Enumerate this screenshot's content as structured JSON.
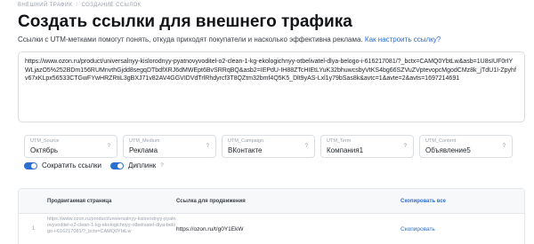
{
  "breadcrumb": {
    "items": [
      "ВНЕШНИЙ ТРАФИК",
      "СОЗДАНИЕ ССЫЛОК"
    ],
    "separator": "/"
  },
  "page": {
    "title": "Создать ссылки для внешнего трафика",
    "subtitle": "Ссылки с UTM-метками помогут понять, откуда приходят покупатели и насколько эффективна реклама.",
    "help_link": "Как настроить ссылку?"
  },
  "url_input": {
    "value": "https://www.ozon.ru/product/universalnyy-kislorodnyy-pyatnovyvoditel-o2-clean-1-kg-ekologichnyy-otbelivatel-dlya-belogo-i-616217081/?_bctx=CAMQ0YbtLw&asb=1U8sIUF0rIYWLjazO5%252BDm156RUMnvthGjdd8segqDTbdfXRJ6dMWEpt6BvSRRqBQ&asb2=IEPdU-IH88ZTcHIEtLYuK32bhuwcsbyVtKS4bg66SZVuZVptevopcMgodCMz8k_jTdU1I-Zpyhfv67xKLpx56533CTGwFYwHRZRtiL3gBXJ71v82AV4GGVIDVdTrlRhdyrcf3T8QZtm32bmf4Q5K5_Dlt9yAS-Lxl1y79bSas8k&avtc=1&avte=2&avts=1697214691"
  },
  "utm_params": [
    {
      "label": "UTM_Source",
      "value": "Октябрь",
      "help": "?"
    },
    {
      "label": "UTM_Medium",
      "value": "Реклама",
      "help": "?"
    },
    {
      "label": "UTM_Campaign",
      "value": "ВКонтакте",
      "help": "?"
    },
    {
      "label": "UTM_Term",
      "value": "Компания1",
      "help": "?"
    },
    {
      "label": "UTM_Content",
      "value": "Объявление5",
      "help": "?"
    }
  ],
  "toggles": {
    "shorten": {
      "label": "Сократить ссылки",
      "on": true
    },
    "deeplink": {
      "label": "Диплинк",
      "on": true,
      "help": "?"
    }
  },
  "table": {
    "headers": {
      "page": "Продвигаемая страница",
      "link": "Ссылка для продвижения",
      "copy_all": "Скопировать все"
    },
    "rows": [
      {
        "num": "1",
        "page": "https://www.ozon.ru/product/universalnyy-kislorodnyy-pyatnovyvoditel-o2-clean-1-kg-ekologichnyy-otbelivatel-dlya-belogo-i-616217081/?_bctx=CAMQ0YbtLw",
        "link": "https://ozon.ru/t/g0Y1EkW",
        "copy": "Скопировать"
      }
    ]
  },
  "colors": {
    "accent": "#2c6fd1",
    "muted": "#9aa1ab",
    "border": "#d8dce1"
  }
}
